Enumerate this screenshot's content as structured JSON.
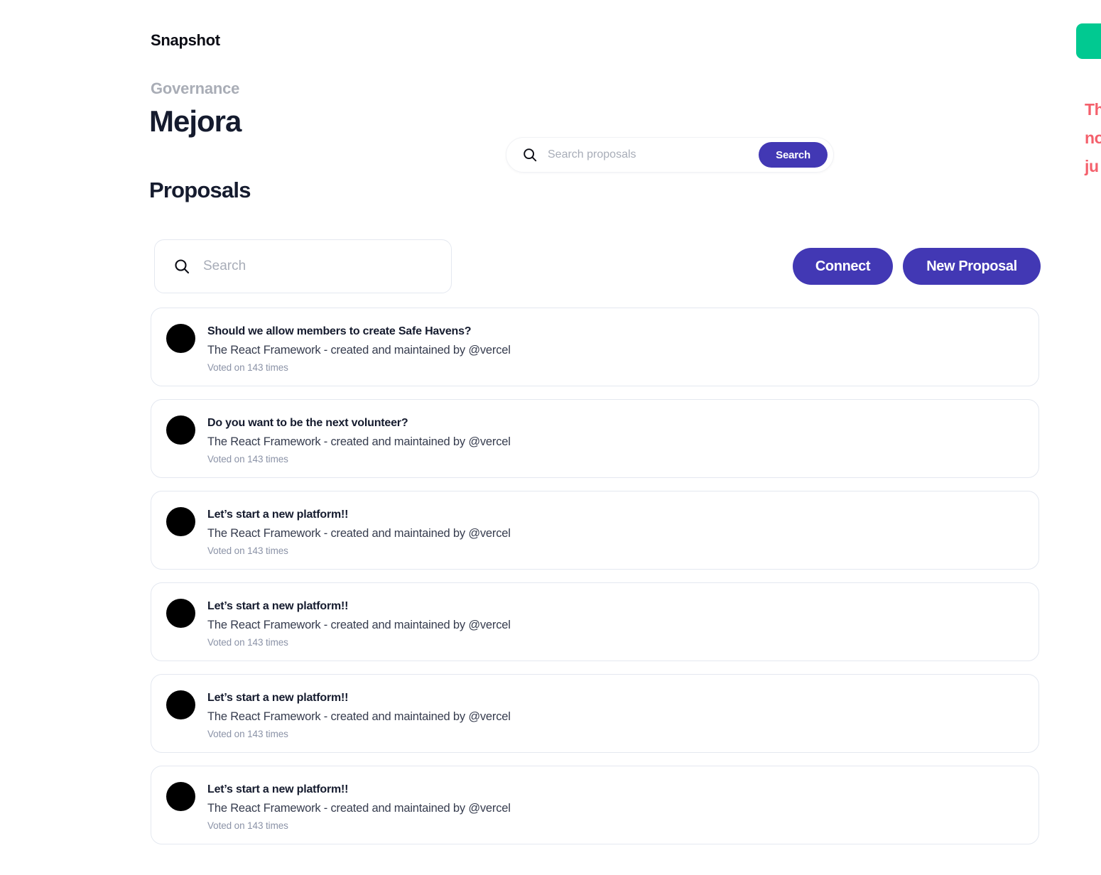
{
  "brand": {
    "name": "Snapshot"
  },
  "header": {
    "eyebrow": "Governance",
    "org_name": "Mejora",
    "section_title": "Proposals"
  },
  "top_search": {
    "placeholder": "Search proposals",
    "value": "",
    "button_label": "Search",
    "icon": "search-icon"
  },
  "main_search": {
    "placeholder": "Search",
    "value": "",
    "icon": "search-icon"
  },
  "actions": {
    "connect_label": "Connect",
    "new_proposal_label": "New Proposal"
  },
  "proposals": [
    {
      "title": "Should we allow members to create Safe Havens?",
      "description": "The React Framework - created and maintained by @vercel",
      "meta": "Voted on 143 times"
    },
    {
      "title": "Do you want to be the next volunteer?",
      "description": "The React Framework - created and maintained by @vercel",
      "meta": "Voted on 143 times"
    },
    {
      "title": "Let’s start a new platform!!",
      "description": "The React Framework - created and maintained by @vercel",
      "meta": "Voted on 143 times"
    },
    {
      "title": "Let’s start a new platform!!",
      "description": "The React Framework - created and maintained by @vercel",
      "meta": "Voted on 143 times"
    },
    {
      "title": "Let’s start a new platform!!",
      "description": "The React Framework - created and maintained by @vercel",
      "meta": "Voted on 143 times"
    },
    {
      "title": "Let’s start a new platform!!",
      "description": "The React Framework - created and maintained by @vercel",
      "meta": "Voted on 143 times"
    }
  ],
  "edge_decorations": {
    "green_block": {
      "color": "#01c991"
    },
    "note_lines": [
      "Th",
      "no",
      "ju"
    ],
    "note_color": "#f4606c"
  },
  "colors": {
    "accent_purple": "#4238b4",
    "text_dark": "#151b2e",
    "text_muted": "#8b93a7",
    "border": "#e4e8f0",
    "green": "#01c991",
    "red": "#f4606c"
  }
}
